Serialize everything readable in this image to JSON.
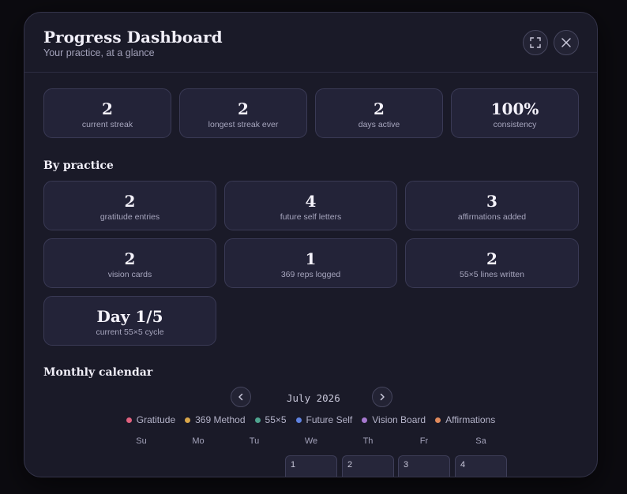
{
  "header": {
    "title": "Progress Dashboard",
    "subtitle": "Your practice, at a glance"
  },
  "icons": {
    "expand": "expand-icon",
    "close": "close-icon",
    "prev": "chevron-left-icon",
    "next": "chevron-right-icon"
  },
  "summary": [
    {
      "value": "2",
      "label": "current streak"
    },
    {
      "value": "2",
      "label": "longest streak ever"
    },
    {
      "value": "2",
      "label": "days active"
    },
    {
      "value": "100%",
      "label": "consistency"
    }
  ],
  "by_practice": {
    "heading": "By practice",
    "items": [
      {
        "value": "2",
        "label": "gratitude entries"
      },
      {
        "value": "4",
        "label": "future self letters"
      },
      {
        "value": "3",
        "label": "affirmations added"
      },
      {
        "value": "2",
        "label": "vision cards"
      },
      {
        "value": "1",
        "label": "369 reps logged"
      },
      {
        "value": "2",
        "label": "55×5 lines written"
      },
      {
        "value": "Day 1/5",
        "label": "current 55×5 cycle"
      }
    ]
  },
  "calendar": {
    "heading": "Monthly calendar",
    "month": "July 2026",
    "legend": [
      {
        "label": "Gratitude",
        "color": "#e0617e"
      },
      {
        "label": "369 Method",
        "color": "#d9a64a"
      },
      {
        "label": "55×5",
        "color": "#4fa48f"
      },
      {
        "label": "Future Self",
        "color": "#5f82e0"
      },
      {
        "label": "Vision Board",
        "color": "#a678cf"
      },
      {
        "label": "Affirmations",
        "color": "#e08a5c"
      }
    ],
    "weekdays": [
      "Su",
      "Mo",
      "Tu",
      "We",
      "Th",
      "Fr",
      "Sa"
    ],
    "days": [
      "1",
      "2",
      "3",
      "4"
    ]
  }
}
